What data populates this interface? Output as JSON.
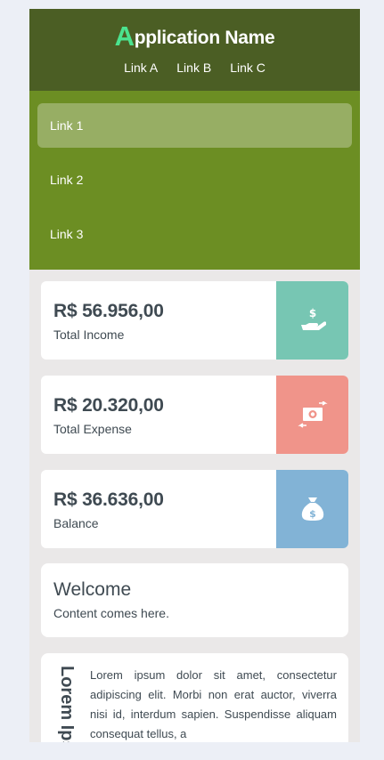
{
  "header": {
    "brand_first": "A",
    "brand_rest": "pplication Name",
    "links": [
      "Link A",
      "Link B",
      "Link C"
    ]
  },
  "sidenav": {
    "items": [
      "Link 1",
      "Link 2",
      "Link 3"
    ],
    "active_index": 0
  },
  "stats": [
    {
      "value": "R$ 56.956,00",
      "label": "Total Income",
      "icon": "hand-money-icon",
      "color": "#77c6b3"
    },
    {
      "value": "R$ 20.320,00",
      "label": "Total Expense",
      "icon": "money-exchange-icon",
      "color": "#f0948a"
    },
    {
      "value": "R$ 36.636,00",
      "label": "Balance",
      "icon": "money-bag-icon",
      "color": "#82b3d6"
    }
  ],
  "welcome": {
    "title": "Welcome",
    "text": "Content comes here."
  },
  "lorem": {
    "vertical_title": "Lorem Ipsum",
    "text": "Lorem ipsum dolor sit amet, consectetur adipiscing elit. Morbi non erat auctor, viverra nisi id, interdum sapien. Suspendisse aliquam consequat tellus, a"
  },
  "colors": {
    "header_bg": "#4b5e24",
    "sidenav_bg": "#6c8e23",
    "active_item_bg": "#97ae64",
    "brand_accent": "#4be38f"
  }
}
